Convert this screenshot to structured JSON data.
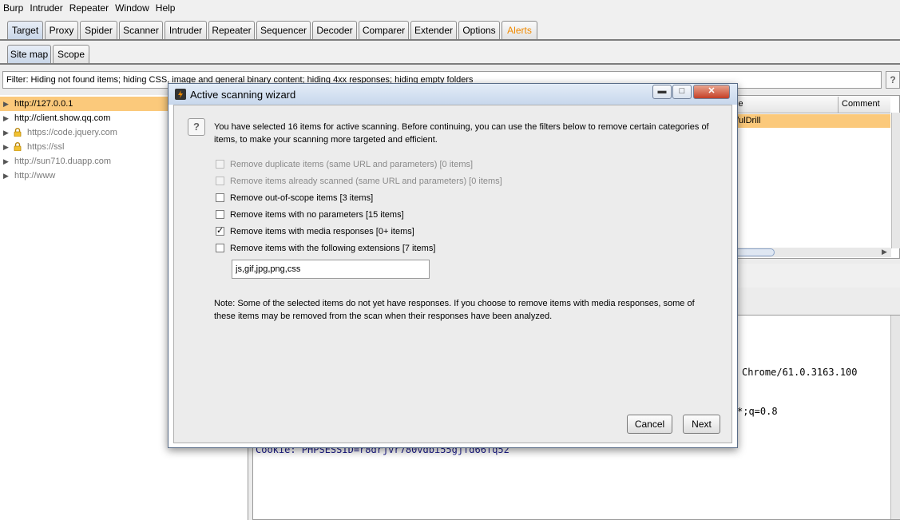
{
  "menu": [
    "Burp",
    "Intruder",
    "Repeater",
    "Window",
    "Help"
  ],
  "main_tabs": [
    "Target",
    "Proxy",
    "Spider",
    "Scanner",
    "Intruder",
    "Repeater",
    "Sequencer",
    "Decoder",
    "Comparer",
    "Extender",
    "Options",
    "Alerts"
  ],
  "sub_tabs": [
    "Site map",
    "Scope"
  ],
  "filter": {
    "text": "Filter:  Hiding not found items;  hiding CSS, image and general binary content;  hiding 4xx responses;  hiding empty folders",
    "help": "?"
  },
  "tree": [
    {
      "label": "http://127.0.0.1",
      "selected": true,
      "lock": false,
      "muted": false
    },
    {
      "label": "http://client.show.qq.com",
      "selected": false,
      "lock": false,
      "muted": false
    },
    {
      "label": "https://code.jquery.com",
      "selected": false,
      "lock": true,
      "muted": true
    },
    {
      "label": "https://ssl",
      "selected": false,
      "lock": true,
      "muted": true
    },
    {
      "label": "http://sun710.duapp.com",
      "selected": false,
      "lock": false,
      "muted": true
    },
    {
      "label": "http://www",
      "selected": false,
      "lock": false,
      "muted": true
    }
  ],
  "right_table": {
    "headers": [
      "le",
      "Comment"
    ],
    "row_value": "/ulDrill"
  },
  "request_lines": {
    "ua": "Chrome/61.0.3163.100",
    "accept": "*;q=0.8",
    "cookie": "Cookie: PHPSESSID=r8drjvr780vdbi55gjfd66fq52"
  },
  "dialog": {
    "title": "Active scanning wizard",
    "intro": "You have selected 16 items for active scanning. Before continuing, you can use the filters below to remove certain categories of items, to make your scanning more targeted and efficient.",
    "options": [
      {
        "label": "Remove duplicate items (same URL and parameters) [0 items]",
        "checked": false,
        "disabled": true
      },
      {
        "label": "Remove items already scanned (same URL and parameters) [0 items]",
        "checked": false,
        "disabled": true
      },
      {
        "label": "Remove out-of-scope items [3 items]",
        "checked": false,
        "disabled": false
      },
      {
        "label": "Remove items with no parameters [15 items]",
        "checked": false,
        "disabled": false
      },
      {
        "label": "Remove items with media responses [0+ items]",
        "checked": true,
        "disabled": false
      },
      {
        "label": "Remove items with the following extensions [7 items]",
        "checked": false,
        "disabled": false
      }
    ],
    "extensions": "js,gif,jpg,png,css",
    "note": "Note: Some of the selected items do not yet have responses. If you choose to remove items with media responses, some of these items may be removed from the scan when their responses have been analyzed.",
    "cancel": "Cancel",
    "next": "Next"
  },
  "colors": {
    "selection": "#fbc97b",
    "alert_tab": "#f08a00"
  }
}
